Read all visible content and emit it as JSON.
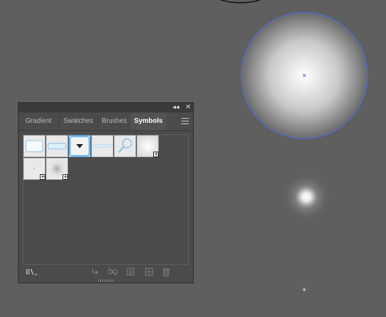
{
  "panel": {
    "tabs": [
      {
        "label": "Gradient"
      },
      {
        "label": "Swatches"
      },
      {
        "label": "Brushes"
      },
      {
        "label": "Symbols"
      }
    ],
    "active_tab": "Symbols",
    "collapse_glyph": "◂◂",
    "close_glyph": "✕",
    "plus_glyph": "+",
    "symbols": [
      {
        "name": "rectangle-button-symbol"
      },
      {
        "name": "slider-bar-symbol"
      },
      {
        "name": "dropdown-button-symbol"
      },
      {
        "name": "thin-bar-symbol"
      },
      {
        "name": "magnifier-symbol"
      },
      {
        "name": "soft-glow-symbol"
      },
      {
        "name": "tiny-dot-symbol"
      },
      {
        "name": "radial-blur-symbol"
      }
    ],
    "bottom_icons": [
      "symbol-libraries-icon",
      "place-symbol-icon",
      "break-link-icon",
      "symbol-options-icon",
      "new-symbol-icon",
      "delete-icon"
    ]
  },
  "colors": {
    "canvas_bg": "#5f5f5f",
    "selection": "#4c6fe0",
    "panel_bg": "#4b4b4b"
  }
}
